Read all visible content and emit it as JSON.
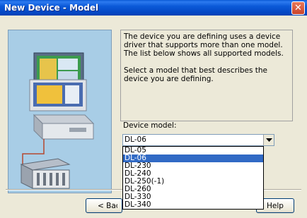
{
  "window": {
    "title": "New Device - Model",
    "close_glyph": "✕"
  },
  "info": {
    "paragraph1": "The device you are defining uses a device driver that supports more than one model.  The list below shows all supported models.",
    "paragraph2": "Select  a model that best describes the device you are defining."
  },
  "device_model": {
    "label": "Device model:",
    "selected": "DL-06",
    "options": [
      "DL-05",
      "DL-06",
      "DL-230",
      "DL-240",
      "DL-250(-1)",
      "DL-260",
      "DL-330",
      "DL-340"
    ],
    "highlighted_index": 1
  },
  "buttons": {
    "back": "< Back",
    "help": "Help"
  },
  "colors": {
    "title_bar": "#0a5bd6",
    "selection": "#316ac5"
  }
}
